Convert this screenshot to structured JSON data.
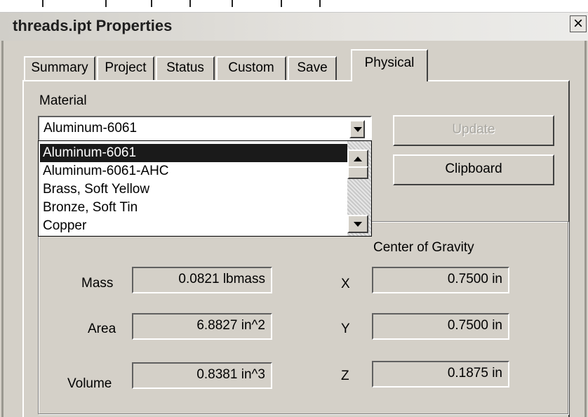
{
  "window": {
    "title": "threads.ipt Properties",
    "close_label": "×"
  },
  "tabs": [
    {
      "label": "Summary"
    },
    {
      "label": "Project"
    },
    {
      "label": "Status"
    },
    {
      "label": "Custom"
    },
    {
      "label": "Save"
    },
    {
      "label": "Physical",
      "active": true
    }
  ],
  "material": {
    "label": "Material",
    "selected": "Aluminum-6061",
    "options": [
      "Aluminum-6061",
      "Aluminum-6061-AHC",
      "Brass, Soft Yellow",
      "Bronze, Soft Tin",
      "Copper"
    ],
    "highlighted": "Aluminum-6061"
  },
  "buttons": {
    "update_label": "Update",
    "clipboard_label": "Clipboard"
  },
  "properties": {
    "mass_label": "Mass",
    "mass_value": "0.0821 lbmass",
    "area_label": "Area",
    "area_value": "6.8827 in^2",
    "volume_label": "Volume",
    "volume_value": "0.8381 in^3"
  },
  "center_of_gravity": {
    "label": "Center of Gravity",
    "x_label": "X",
    "x_value": "0.7500 in",
    "y_label": "Y",
    "y_value": "0.7500 in",
    "z_label": "Z",
    "z_value": "0.1875 in"
  }
}
